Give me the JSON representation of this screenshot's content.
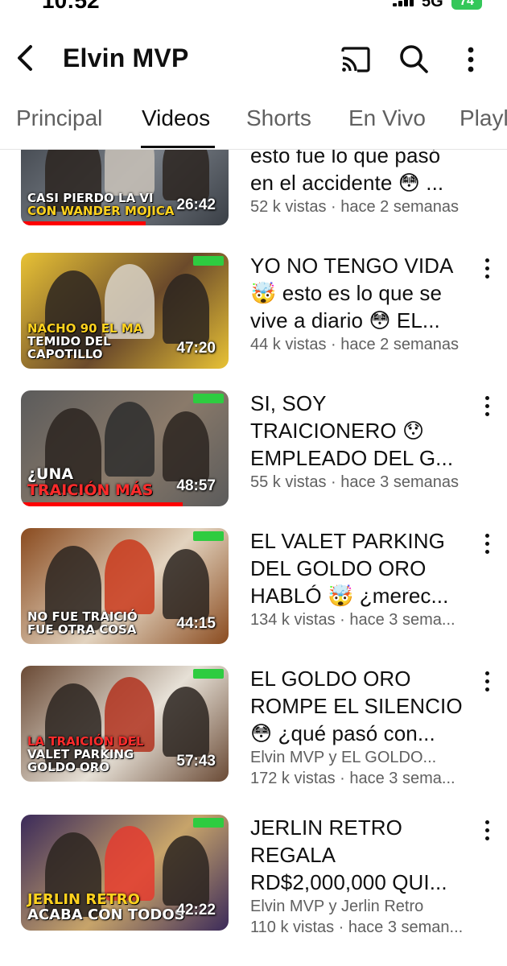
{
  "status_bar": {
    "time": "10:52",
    "network": "5G",
    "battery": "74"
  },
  "header": {
    "title": "Elvin MVP",
    "icons": {
      "back": "back-arrow-icon",
      "cast": "cast-icon",
      "search": "search-icon",
      "more": "more-vertical-icon"
    }
  },
  "tabs": [
    {
      "label": "Principal",
      "active": false
    },
    {
      "label": "Videos",
      "active": true
    },
    {
      "label": "Shorts",
      "active": false
    },
    {
      "label": "En Vivo",
      "active": false
    },
    {
      "label": "Playl",
      "active": false
    }
  ],
  "videos": [
    {
      "title_lines": [
        "esto fue lo que pasó",
        "en el accidente 😳 ..."
      ],
      "meta_lines": [
        "52 k vistas · hace 2 semanas"
      ],
      "duration": "26:42",
      "thumb_caption": [
        "CASI PIERDO LA VI",
        "CON WANDER MOJICA"
      ],
      "progress": 0.6,
      "palette": [
        "#3a3f46",
        "#7a8088",
        "#c9c2b8"
      ]
    },
    {
      "title_lines": [
        "YO NO TENGO VIDA",
        "🤯 esto es lo que se",
        "vive a diario 😳 EL..."
      ],
      "meta_lines": [
        "44 k vistas · hace 2 semanas"
      ],
      "duration": "47:20",
      "thumb_caption": [
        "NACHO 90 EL MA",
        "TEMIDO DEL CAPOTILLO"
      ],
      "progress": 0,
      "palette": [
        "#e8c235",
        "#6b4a2b",
        "#d9d4c8"
      ]
    },
    {
      "title_lines": [
        "SI, SOY",
        "TRAICIONERO 😯",
        "EMPLEADO DEL G..."
      ],
      "meta_lines": [
        "55 k vistas · hace 3 semanas"
      ],
      "duration": "48:57",
      "thumb_caption": [
        "¿UNA",
        "TRAICIÓN MÁS"
      ],
      "progress": 0.78,
      "palette": [
        "#5b5b5b",
        "#8a7a6a",
        "#2d2d2d"
      ]
    },
    {
      "title_lines": [
        "EL VALET PARKING",
        "DEL GOLDO ORO",
        "HABLÓ 🤯 ¿merec..."
      ],
      "meta_lines": [
        "134 k vistas · hace 3 sema..."
      ],
      "duration": "44:15",
      "thumb_caption": [
        "NO FUE TRAICIÓ",
        "FUE OTRA COSA"
      ],
      "progress": 0,
      "palette": [
        "#8a4b1f",
        "#e2d3bf",
        "#c93a1c"
      ]
    },
    {
      "title_lines": [
        "EL GOLDO ORO",
        "ROMPE EL SILENCIO",
        "😳 ¿qué pasó con..."
      ],
      "meta_lines": [
        "Elvin MVP y EL GOLDO...",
        "172 k vistas · hace 3 sema..."
      ],
      "duration": "57:43",
      "thumb_caption": [
        "LA TRAICIÓN DEL",
        "VALET PARKING",
        "GOLDO ORO"
      ],
      "progress": 0,
      "palette": [
        "#6a4a35",
        "#e6e0d6",
        "#b2331f"
      ]
    },
    {
      "title_lines": [
        "JERLIN RETRO",
        "REGALA",
        "RD$2,000,000 QUI..."
      ],
      "meta_lines": [
        "Elvin MVP y Jerlin Retro",
        "110 k vistas · hace 3 seman..."
      ],
      "duration": "42:22",
      "thumb_caption": [
        "JERLIN RETRO",
        "ACABA CON TODOS"
      ],
      "progress": 0,
      "palette": [
        "#3b2a5a",
        "#c7a46a",
        "#e43b2f"
      ]
    }
  ]
}
